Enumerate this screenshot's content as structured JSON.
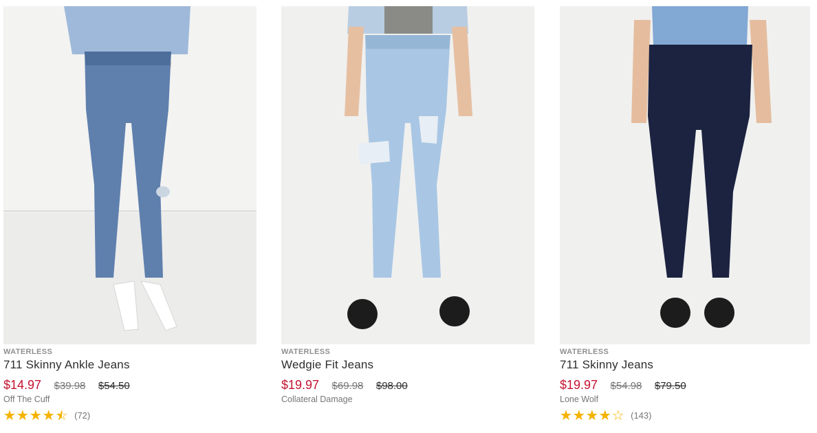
{
  "products": [
    {
      "tag": "WATERLESS",
      "name": "711 Skinny Ankle Jeans",
      "sale_price": "$14.97",
      "was_price": "$39.98",
      "original_price": "$54.50",
      "color_name": "Off The Cuff",
      "rating": 4.5,
      "review_count": "(72)",
      "image_icon": "product-photo-skinny-ankle-jeans"
    },
    {
      "tag": "WATERLESS",
      "name": "Wedgie Fit Jeans",
      "sale_price": "$19.97",
      "was_price": "$69.98",
      "original_price": "$98.00",
      "color_name": "Collateral Damage",
      "image_icon": "product-photo-wedgie-fit-jeans"
    },
    {
      "tag": "WATERLESS",
      "name": "711 Skinny Jeans",
      "sale_price": "$19.97",
      "was_price": "$54.98",
      "original_price": "$79.50",
      "color_name": "Lone Wolf",
      "rating": 4.0,
      "review_count": "(143)",
      "image_icon": "product-photo-skinny-jeans"
    }
  ],
  "colors": {
    "sale": "#c41230",
    "star": "#f5b301",
    "tag": "#8f8f8f",
    "photo_background": "#f0f0ef"
  },
  "star_glyphs": {
    "empty": "☆☆☆☆☆",
    "full": "★★★★★"
  }
}
